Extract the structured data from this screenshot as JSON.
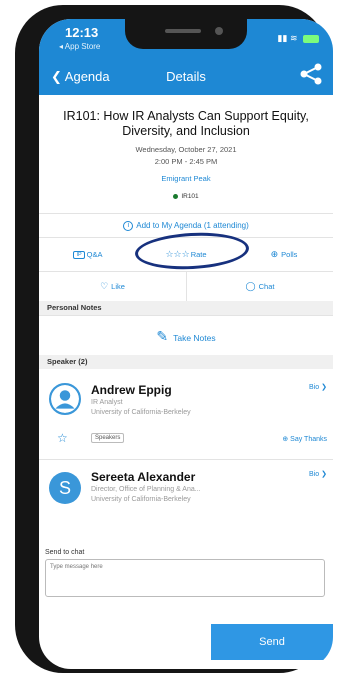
{
  "status": {
    "time": "12:13",
    "back_app": "◂ App Store"
  },
  "nav": {
    "back_label": "Agenda",
    "title": "Details"
  },
  "session": {
    "title": "IR101: How IR Analysts Can Support Equity, Diversity, and Inclusion",
    "date": "Wednesday, October 27, 2021",
    "time": "2:00 PM - 2:45 PM",
    "location": "Emigrant Peak",
    "code": "IR101"
  },
  "actions": {
    "add_agenda": "Add to My Agenda (1 attending)",
    "qa_badge": "IP",
    "qa": "Q&A",
    "rate_stars": "☆☆☆",
    "rate": "Rate",
    "polls": "Polls",
    "like": "Like",
    "chat": "Chat"
  },
  "notes": {
    "header": "Personal Notes",
    "take_notes": "Take Notes"
  },
  "speakers": {
    "header": "Speaker (2)",
    "items": [
      {
        "name": "Andrew Eppig",
        "role": "IR Analyst",
        "org": "University of California-Berkeley",
        "bio": "Bio",
        "tag": "Speakers",
        "thanks": "Say Thanks"
      },
      {
        "initial": "S",
        "name": "Sereeta Alexander",
        "role": "Director, Office of Planning & Ana...",
        "org": "University of California-Berkeley",
        "bio": "Bio"
      }
    ]
  },
  "chat": {
    "label": "Send to chat",
    "placeholder": "Type message here",
    "send": "Send"
  },
  "colors": {
    "brand": "#1e88d4",
    "send": "#2f97e4",
    "annotation": "#17317e"
  }
}
